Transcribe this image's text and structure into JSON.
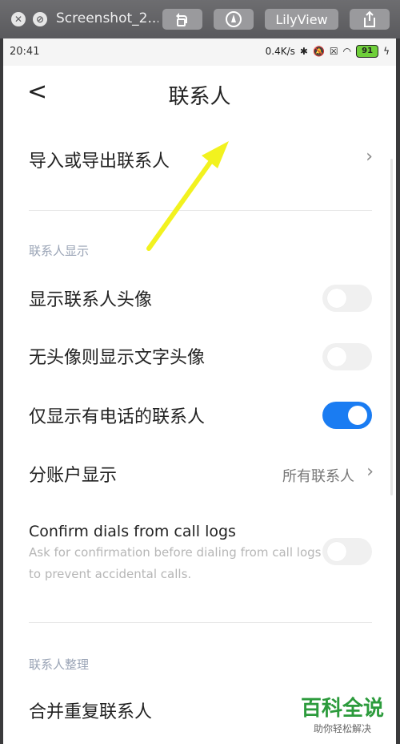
{
  "window": {
    "title": "Screenshot_2...",
    "viewer_button": "LilyView"
  },
  "status_bar": {
    "time": "20:41",
    "net_speed": "0.4K/s",
    "battery": "91"
  },
  "header": {
    "back": "<",
    "title": "联系人"
  },
  "rows": {
    "import_export": {
      "label": "导入或导出联系人"
    },
    "section_display": "联系人显示",
    "show_avatar": {
      "label": "显示联系人头像",
      "enabled": false
    },
    "text_avatar": {
      "label": "无头像则显示文字头像",
      "enabled": false
    },
    "phone_only": {
      "label": "仅显示有电话的联系人",
      "enabled": true
    },
    "account_display": {
      "label": "分账户显示",
      "value": "所有联系人"
    },
    "confirm_dials": {
      "label": "Confirm dials from call logs",
      "description": "Ask for confirmation before dialing from call logs to prevent accidental calls.",
      "enabled": false
    },
    "section_organize": "联系人整理",
    "merge_duplicates": {
      "label": "合并重复联系人"
    }
  },
  "watermark": {
    "main": "百科全说",
    "sub": "助你轻松解决"
  },
  "colors": {
    "accent": "#1a7cf2",
    "section_label": "#9aa4b6",
    "annotation_arrow": "#f2f21f"
  }
}
